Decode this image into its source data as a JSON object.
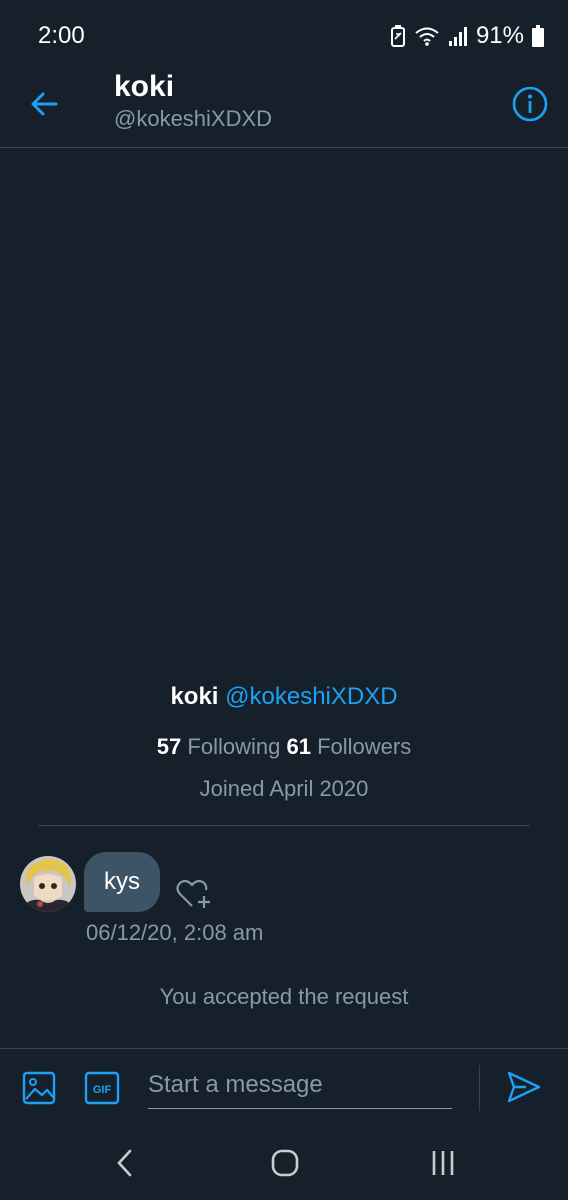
{
  "status_bar": {
    "time": "2:00",
    "battery_percent": "91%",
    "icons": [
      "battery-saver-icon",
      "wifi-icon",
      "signal-icon",
      "battery-icon"
    ]
  },
  "header": {
    "title": "koki",
    "handle": "@kokeshiXDXD",
    "icons": [
      "back-arrow-icon",
      "info-icon"
    ]
  },
  "profile_summary": {
    "name": "koki",
    "handle": "@kokeshiXDXD",
    "following_count": "57",
    "following_label": "Following",
    "followers_count": "61",
    "followers_label": "Followers",
    "joined": "Joined April 2020"
  },
  "conversation": {
    "message_text": "kys",
    "timestamp": "06/12/20, 2:08 am",
    "system_message": "You accepted the request"
  },
  "composer": {
    "placeholder": "Start a message",
    "value": "",
    "icons": [
      "image-icon",
      "gif-icon",
      "send-icon"
    ]
  },
  "nav_bar": {
    "icons": [
      "nav-back-icon",
      "nav-home-icon",
      "nav-recent-icon"
    ]
  },
  "colors": {
    "background": "#15202b",
    "accent": "#1da1f2",
    "secondary_text": "#8899a6",
    "bubble": "#3d5466",
    "divider": "#38444d"
  }
}
